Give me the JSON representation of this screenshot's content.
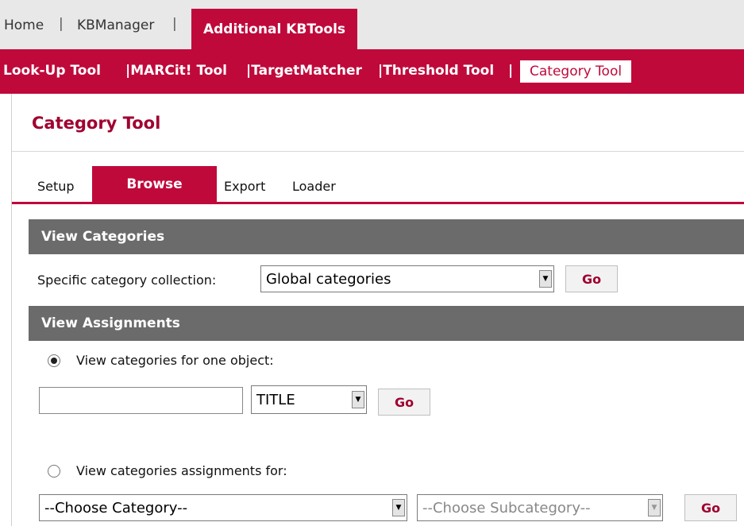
{
  "top_nav": {
    "home": "Home",
    "kbmanager": "KBManager",
    "additional_kbtools": "Additional KBTools",
    "separator": "|"
  },
  "sub_nav": {
    "items": [
      {
        "label": "Look-Up Tool"
      },
      {
        "label": "|MARCit! Tool"
      },
      {
        "label": "|TargetMatcher"
      },
      {
        "label": "|Threshold Tool"
      },
      {
        "label": "|"
      },
      {
        "label": "Category Tool"
      }
    ]
  },
  "page": {
    "title": "Category Tool"
  },
  "tabs": [
    {
      "label": "Setup"
    },
    {
      "label": "Browse"
    },
    {
      "label": "Export"
    },
    {
      "label": "Loader"
    }
  ],
  "view_categories": {
    "heading": "View Categories",
    "collection_label": "Specific category collection:",
    "collection_value": "Global categories",
    "go_label": "Go"
  },
  "view_assignments": {
    "heading": "View Assignments",
    "option1_label": "View categories for one object:",
    "object_input_value": "",
    "field_select_value": "TITLE",
    "go1_label": "Go",
    "option2_label": "View categories assignments for:",
    "category_select_value": "--Choose Category--",
    "subcategory_select_value": "--Choose Subcategory--",
    "go2_label": "Go"
  },
  "colors": {
    "brand": "#c0093b",
    "section_bar": "#6b6b6b",
    "title": "#a00030"
  }
}
